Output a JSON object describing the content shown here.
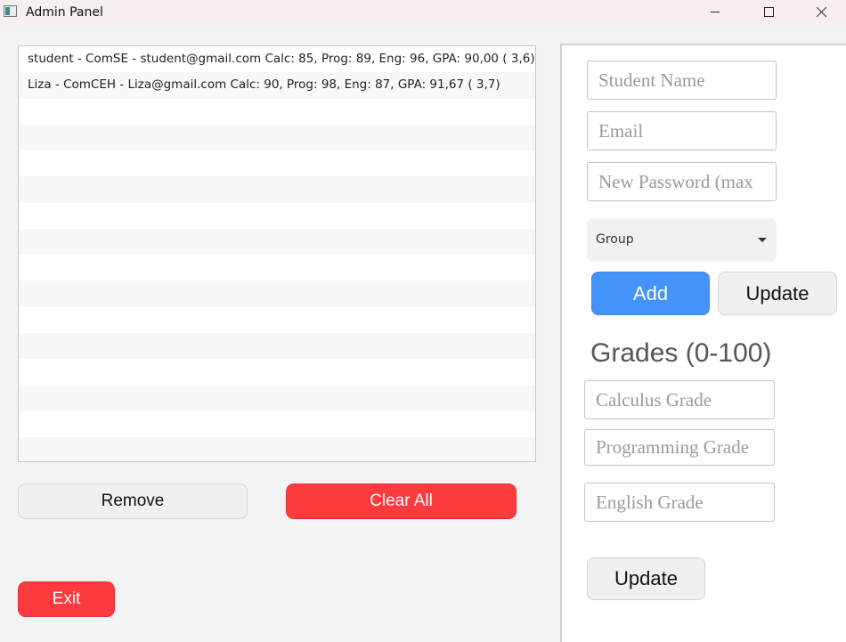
{
  "window": {
    "title": "Admin Panel"
  },
  "students": {
    "rows": [
      "student - ComSE - student@gmail.com Calc: 85, Prog: 89, Eng: 96, GPA: 90,00 ( 3,6)",
      "Liza - ComCEH - Liza@gmail.com Calc: 90, Prog: 98, Eng: 87, GPA: 91,67 ( 3,7)",
      "",
      "",
      "",
      "",
      "",
      "",
      "",
      "",
      "",
      "",
      "",
      "",
      "",
      ""
    ]
  },
  "actions": {
    "remove_label": "Remove",
    "clear_all_label": "Clear All",
    "exit_label": "Exit"
  },
  "form": {
    "name_placeholder": "Student Name",
    "email_placeholder": "Email",
    "password_placeholder": "New Password (max",
    "group_value": "Group",
    "add_label": "Add",
    "update_label": "Update"
  },
  "grades": {
    "title": "Grades (0-100)",
    "calculus_placeholder": "Calculus Grade",
    "programming_placeholder": "Programming Grade",
    "english_placeholder": "English Grade",
    "update_label": "Update"
  },
  "colors": {
    "accent_blue": "#4393fb",
    "danger_red": "#fd3a3d"
  }
}
